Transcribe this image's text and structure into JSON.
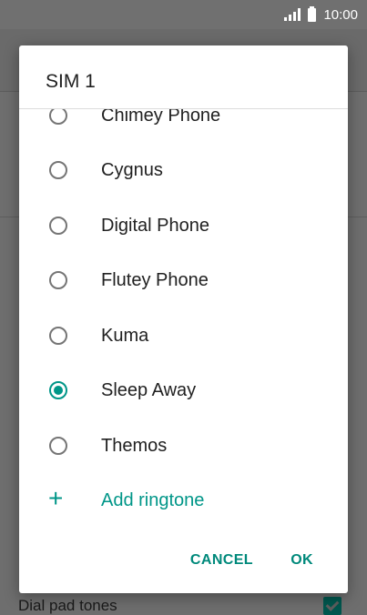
{
  "status_bar": {
    "time": "10:00"
  },
  "dialog": {
    "title": "SIM 1",
    "options": [
      {
        "label": "Chimey Phone",
        "selected": false
      },
      {
        "label": "Cygnus",
        "selected": false
      },
      {
        "label": "Digital Phone",
        "selected": false
      },
      {
        "label": "Flutey Phone",
        "selected": false
      },
      {
        "label": "Kuma",
        "selected": false
      },
      {
        "label": "Sleep Away",
        "selected": true
      },
      {
        "label": "Themos",
        "selected": false
      }
    ],
    "add_label": "Add ringtone",
    "cancel_label": "CANCEL",
    "ok_label": "OK"
  },
  "background": {
    "item_label": "Dial pad tones"
  },
  "colors": {
    "accent": "#009688",
    "scrim": "#6e6e6e"
  }
}
